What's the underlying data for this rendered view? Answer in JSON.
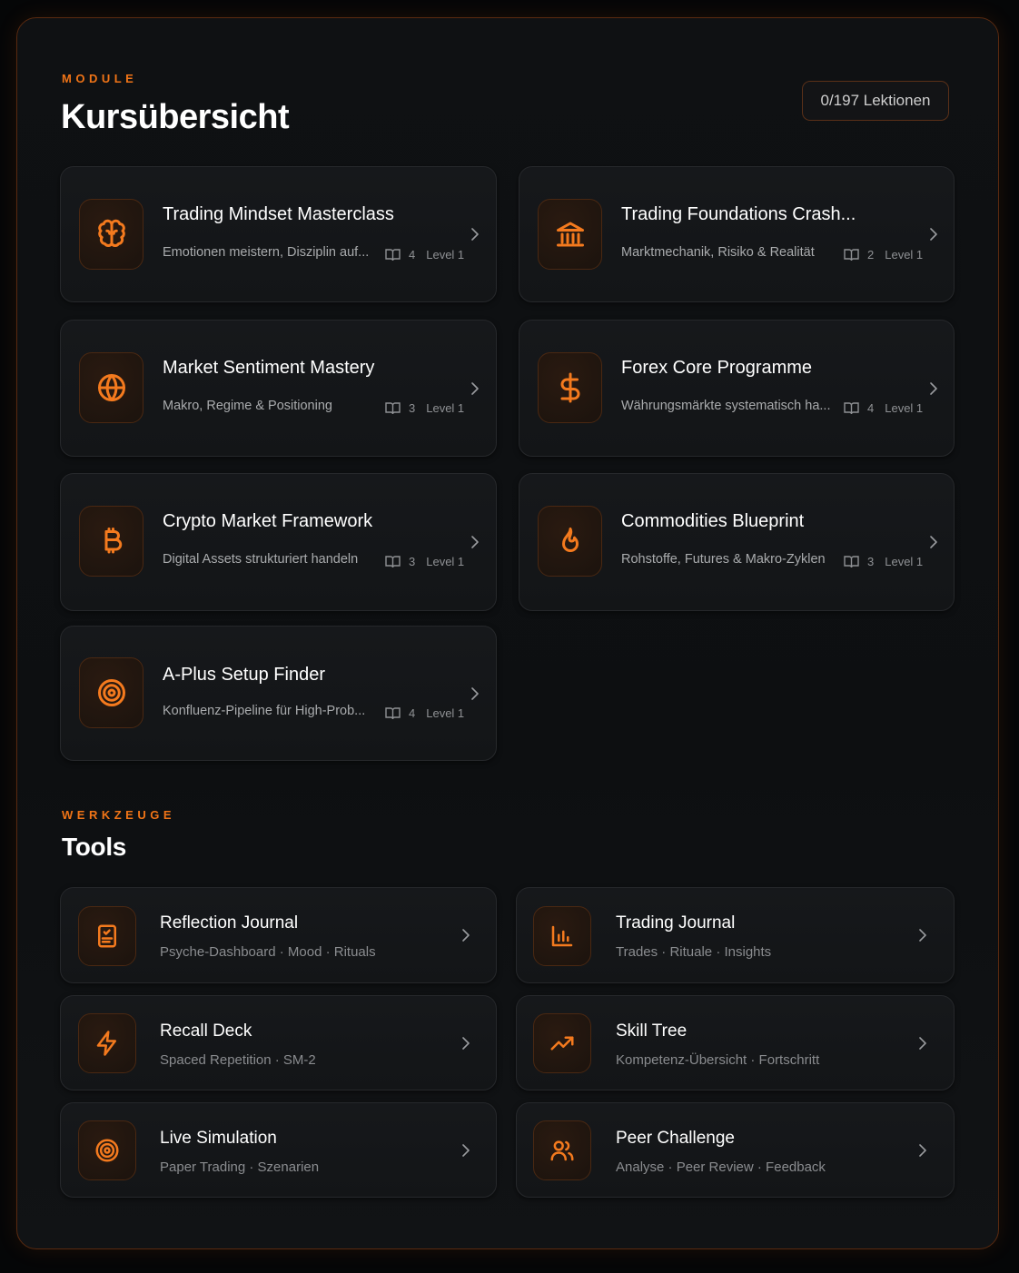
{
  "modules": {
    "eyebrow": "MODULE",
    "title": "Kursübersicht",
    "progress_pill": "0/197 Lektionen",
    "items": [
      {
        "title": "Trading Mindset Masterclass",
        "subtitle": "Emotionen meistern, Disziplin auf...",
        "lessons": "4",
        "level": "Level 1",
        "icon": "brain-icon"
      },
      {
        "title": "Trading Foundations Crash...",
        "subtitle": "Marktmechanik, Risiko & Realität",
        "lessons": "2",
        "level": "Level 1",
        "icon": "bank-icon"
      },
      {
        "title": "Market Sentiment Mastery",
        "subtitle": "Makro, Regime & Positioning",
        "lessons": "3",
        "level": "Level 1",
        "icon": "globe-icon"
      },
      {
        "title": "Forex Core Programme",
        "subtitle": "Währungsmärkte systematisch ha...",
        "lessons": "4",
        "level": "Level 1",
        "icon": "dollar-icon"
      },
      {
        "title": "Crypto Market Framework",
        "subtitle": "Digital Assets strukturiert handeln",
        "lessons": "3",
        "level": "Level 1",
        "icon": "bitcoin-icon"
      },
      {
        "title": "Commodities Blueprint",
        "subtitle": "Rohstoffe, Futures & Makro-Zyklen",
        "lessons": "3",
        "level": "Level 1",
        "icon": "flame-icon"
      },
      {
        "title": "A-Plus Setup Finder",
        "subtitle": "Konfluenz-Pipeline für High-Prob...",
        "lessons": "4",
        "level": "Level 1",
        "icon": "target-icon"
      }
    ]
  },
  "tools": {
    "eyebrow": "WERKZEUGE",
    "title": "Tools",
    "items": [
      {
        "title": "Reflection Journal",
        "subtitle": "Psyche-Dashboard · Mood · Rituals",
        "icon": "journal-icon"
      },
      {
        "title": "Trading Journal",
        "subtitle": "Trades · Rituale · Insights",
        "icon": "bar-chart-icon"
      },
      {
        "title": "Recall Deck",
        "subtitle": "Spaced Repetition · SM-2",
        "icon": "lightning-icon"
      },
      {
        "title": "Skill Tree",
        "subtitle": "Kompetenz-Übersicht · Fortschritt",
        "icon": "trending-up-icon"
      },
      {
        "title": "Live Simulation",
        "subtitle": "Paper Trading · Szenarien",
        "icon": "target-icon"
      },
      {
        "title": "Peer Challenge",
        "subtitle": "Analyse · Peer Review · Feedback",
        "icon": "users-icon"
      }
    ]
  },
  "colors": {
    "accent": "#f47a1e",
    "background": "#0f1113",
    "card": "#16181b"
  }
}
